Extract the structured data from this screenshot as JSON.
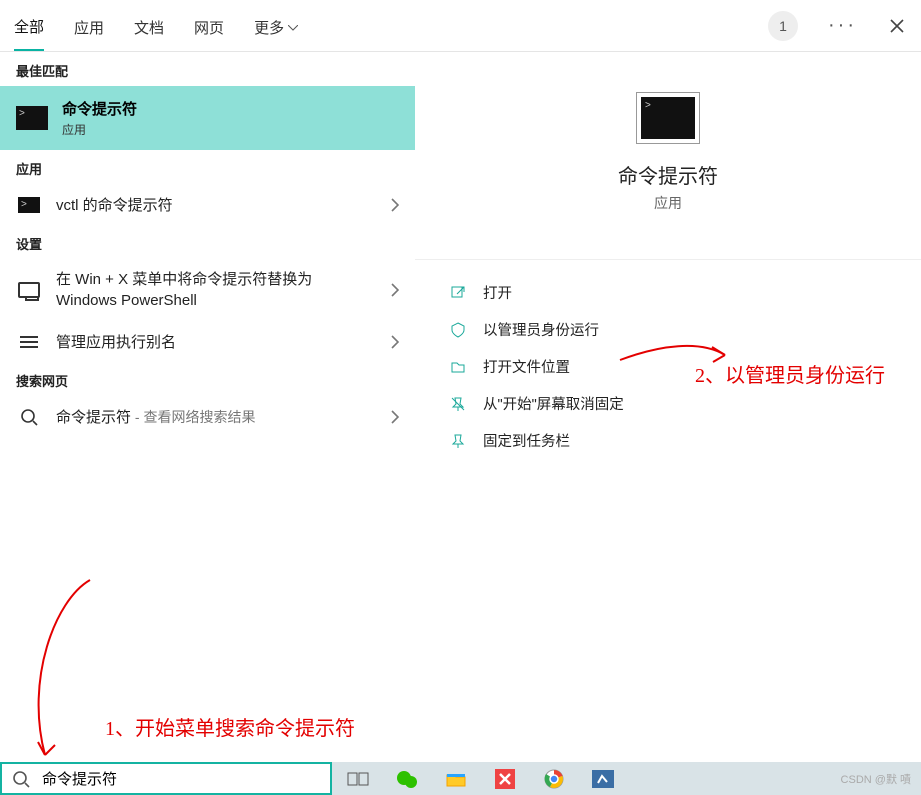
{
  "tabs": {
    "all": "全部",
    "apps": "应用",
    "docs": "文档",
    "web": "网页",
    "more": "更多"
  },
  "top": {
    "counter": "1"
  },
  "sections": {
    "bestmatch": "最佳匹配",
    "apps": "应用",
    "settings": "设置",
    "websearch": "搜索网页"
  },
  "best": {
    "title": "命令提示符",
    "subtitle": "应用"
  },
  "appsList": {
    "item0": "vctl 的命令提示符"
  },
  "settingsList": {
    "item0": "在 Win + X 菜单中将命令提示符替换为 Windows PowerShell",
    "item1": "管理应用执行别名"
  },
  "webList": {
    "item0_main": "命令提示符",
    "item0_sub": " - 查看网络搜索结果"
  },
  "preview": {
    "title": "命令提示符",
    "subtitle": "应用"
  },
  "actions": {
    "open": "打开",
    "runadmin": "以管理员身份运行",
    "openloc": "打开文件位置",
    "unpin": "从\"开始\"屏幕取消固定",
    "pin": "固定到任务栏"
  },
  "search": {
    "value": "命令提示符"
  },
  "annotations": {
    "a1": "1、开始菜单搜索命令提示符",
    "a2": "2、以管理员身份运行"
  },
  "watermark": "CSDN @默 嘖"
}
